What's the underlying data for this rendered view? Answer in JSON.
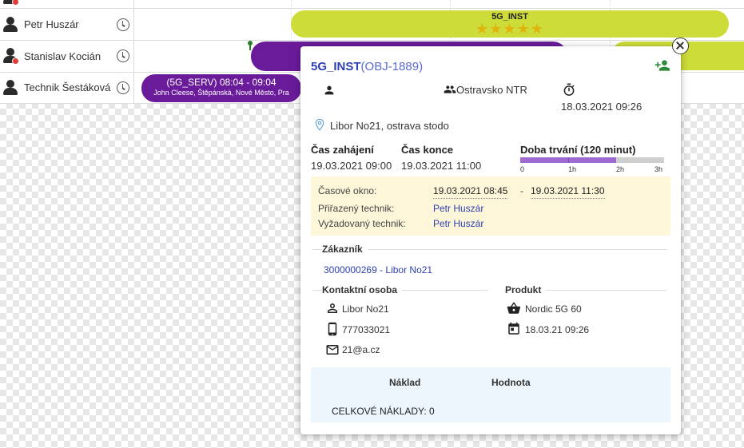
{
  "scheduler": {
    "rows": [
      {
        "name": "Petr Huszár",
        "has_alert": false
      },
      {
        "name": "Stanislav Kocián",
        "has_alert": true
      },
      {
        "name": "Technik Šestáková",
        "has_alert": false
      }
    ],
    "events": {
      "inst": {
        "title": "5G_INST",
        "stars": "★★★★★",
        "rating": 5
      },
      "serv": {
        "title": "(5G_SERV) 08:04 - 09:04",
        "subtitle": "John Cleese, Štěpánská, Nové Město, Pra"
      }
    },
    "colors": {
      "inst": "#cddc39",
      "serv": "#6a1b9a",
      "alert": "#e53935"
    }
  },
  "popup": {
    "code": "5G_INST",
    "obj": "(OBJ-1889)",
    "group": "Ostravsko NTR",
    "created": "18.03.2021 09:26",
    "location": "Libor No21, ostrava stodo",
    "start_label": "Čas zahájení",
    "start_value": "19.03.2021 09:00",
    "end_label": "Čas konce",
    "end_value": "19.03.2021 11:00",
    "duration_label": "Doba trvání (120 minut)",
    "duration_scale": [
      "0",
      "1h",
      "2h",
      "3h"
    ],
    "duration_minutes": 120,
    "window_label": "Časové okno:",
    "window_from": "19.03.2021 08:45",
    "window_sep": "-",
    "window_to": "19.03.2021 11:30",
    "assigned_label": "Přiřazený technik:",
    "assigned_value": "Petr Huszár",
    "required_label": "Vyžadovaný technik:",
    "required_value": "Petr Huszár",
    "customer_title": "Zákazník",
    "customer_link": "3000000269 - Libor No21",
    "contact_title": "Kontaktní osoba",
    "contact_name": "Libor No21",
    "contact_phone": "777033021",
    "contact_email": "21@a.cz",
    "product_title": "Produkt",
    "product_name": "Nordic 5G 60",
    "product_date": "18.03.21 09:26",
    "cost_col1": "Náklad",
    "cost_col2": "Hodnota",
    "cost_total": "CELKOVÉ NÁKLADY: 0"
  },
  "icons": {
    "add_person": "person-add-icon",
    "person": "person-icon",
    "group": "group-icon",
    "timer": "timer-icon",
    "location": "location-pin-icon",
    "contact_person": "person-outline-icon",
    "phone": "smartphone-icon",
    "email": "email-icon",
    "basket": "basket-icon",
    "calendar": "calendar-icon",
    "close": "close-icon",
    "clock": "clock-icon"
  }
}
